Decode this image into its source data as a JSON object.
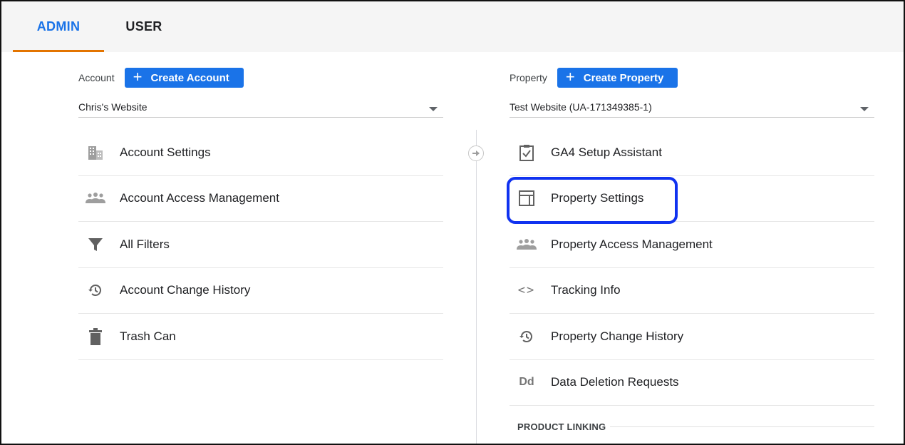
{
  "tabs": [
    {
      "label": "ADMIN",
      "active": true
    },
    {
      "label": "USER",
      "active": false
    }
  ],
  "account": {
    "label": "Account",
    "create_button": "Create Account",
    "selected": "Chris's Website",
    "items": [
      {
        "label": "Account Settings",
        "icon": "building-icon"
      },
      {
        "label": "Account Access Management",
        "icon": "people-icon"
      },
      {
        "label": "All Filters",
        "icon": "filter-icon"
      },
      {
        "label": "Account Change History",
        "icon": "history-icon"
      },
      {
        "label": "Trash Can",
        "icon": "trash-icon"
      }
    ]
  },
  "property": {
    "label": "Property",
    "create_button": "Create Property",
    "selected": "Test Website (UA-171349385-1)",
    "items": [
      {
        "label": "GA4 Setup Assistant",
        "icon": "clipboard-check-icon"
      },
      {
        "label": "Property Settings",
        "icon": "layout-icon",
        "highlighted": true
      },
      {
        "label": "Property Access Management",
        "icon": "people-icon"
      },
      {
        "label": "Tracking Info",
        "icon": "code-icon"
      },
      {
        "label": "Property Change History",
        "icon": "history-icon"
      },
      {
        "label": "Data Deletion Requests",
        "icon": "dd-icon",
        "icon_text": "Dd"
      }
    ],
    "section_header": "PRODUCT LINKING"
  },
  "colors": {
    "accent": "#1a73e8",
    "tab_underline": "#e37400",
    "highlight_box": "#1032f0"
  }
}
